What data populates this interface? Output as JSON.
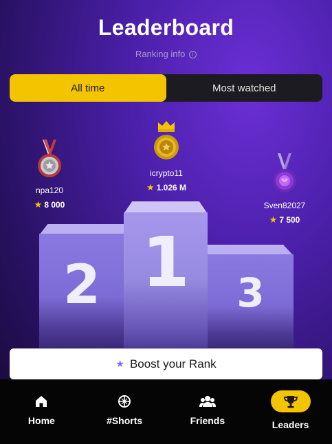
{
  "header": {
    "title": "Leaderboard",
    "ranking_info": "Ranking info",
    "info_icon": "ⓘ"
  },
  "tabs": [
    {
      "label": "All time",
      "active": true
    },
    {
      "label": "Most watched",
      "active": false
    }
  ],
  "leaders": {
    "first": {
      "name": "icrypto11",
      "score": "1.026 M",
      "medal": "gold-medal-icon",
      "rank": "1"
    },
    "second": {
      "name": "npa120",
      "score": "8 000",
      "medal": "silver-medal-icon",
      "rank": "2"
    },
    "third": {
      "name": "Sven82027",
      "score": "7 500",
      "medal": "purple-medal-icon",
      "rank": "3"
    }
  },
  "boost": {
    "label": "Boost your Rank",
    "icon": "star-icon"
  },
  "nav": [
    {
      "label": "Home",
      "icon": "home-icon"
    },
    {
      "label": "#Shorts",
      "icon": "shorts-icon"
    },
    {
      "label": "Friends",
      "icon": "friends-icon"
    },
    {
      "label": "Leaders",
      "icon": "trophy-icon",
      "active": true
    }
  ],
  "colors": {
    "accent": "#f5c400",
    "background_top": "#150933",
    "background_glow": "#6b2fd6",
    "podium": "#7d6cd6"
  }
}
